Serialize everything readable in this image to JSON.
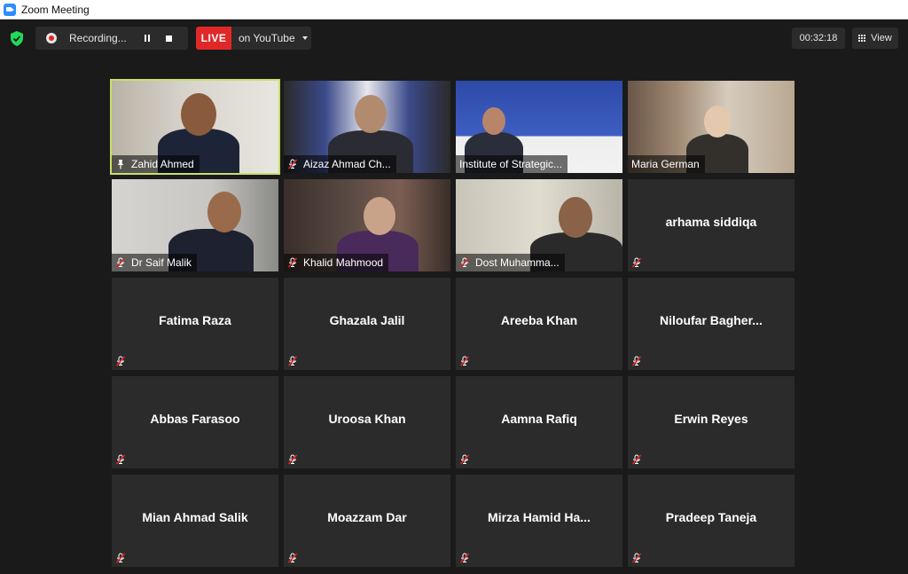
{
  "window": {
    "title": "Zoom Meeting"
  },
  "toolbar": {
    "recording_label": "Recording...",
    "live_label": "LIVE",
    "stream_label": "on YouTube",
    "timer": "00:32:18",
    "view_label": "View"
  },
  "tiles": [
    {
      "name": "Zahid Ahmed",
      "video": true,
      "pinned": true,
      "active": true
    },
    {
      "name": "Aizaz Ahmad Ch...",
      "video": true,
      "muted": true
    },
    {
      "name": "Institute of Strategic...",
      "video": true
    },
    {
      "name": "Maria German",
      "video": true
    },
    {
      "name": "Dr Saif Malik",
      "video": true,
      "muted": true
    },
    {
      "name": "Khalid Mahmood",
      "video": true,
      "muted": true
    },
    {
      "name": "Dost Muhamma...",
      "video": true,
      "muted": true
    },
    {
      "name": "arhama siddiqa",
      "video": false,
      "muted": true
    },
    {
      "name": "Fatima Raza",
      "video": false,
      "muted": true
    },
    {
      "name": "Ghazala Jalil",
      "video": false,
      "muted": true
    },
    {
      "name": "Areeba Khan",
      "video": false,
      "muted": true
    },
    {
      "name": "Niloufar  Bagher...",
      "video": false,
      "muted": true
    },
    {
      "name": "Abbas Farasoo",
      "video": false,
      "muted": true
    },
    {
      "name": "Uroosa Khan",
      "video": false,
      "muted": true
    },
    {
      "name": "Aamna Rafiq",
      "video": false,
      "muted": true
    },
    {
      "name": "Erwin Reyes",
      "video": false,
      "muted": true
    },
    {
      "name": "Mian Ahmad Salik",
      "video": false,
      "muted": true
    },
    {
      "name": "Moazzam Dar",
      "video": false,
      "muted": true
    },
    {
      "name": "Mirza  Hamid  Ha...",
      "video": false,
      "muted": true
    },
    {
      "name": "Pradeep Taneja",
      "video": false,
      "muted": true
    }
  ],
  "colors": {
    "background": "#1a1a1a",
    "tile": "#2b2b2b",
    "live": "#e02828",
    "active_speaker": "#c8e06a",
    "muted_icon": "#e02828",
    "shield": "#23d959"
  }
}
